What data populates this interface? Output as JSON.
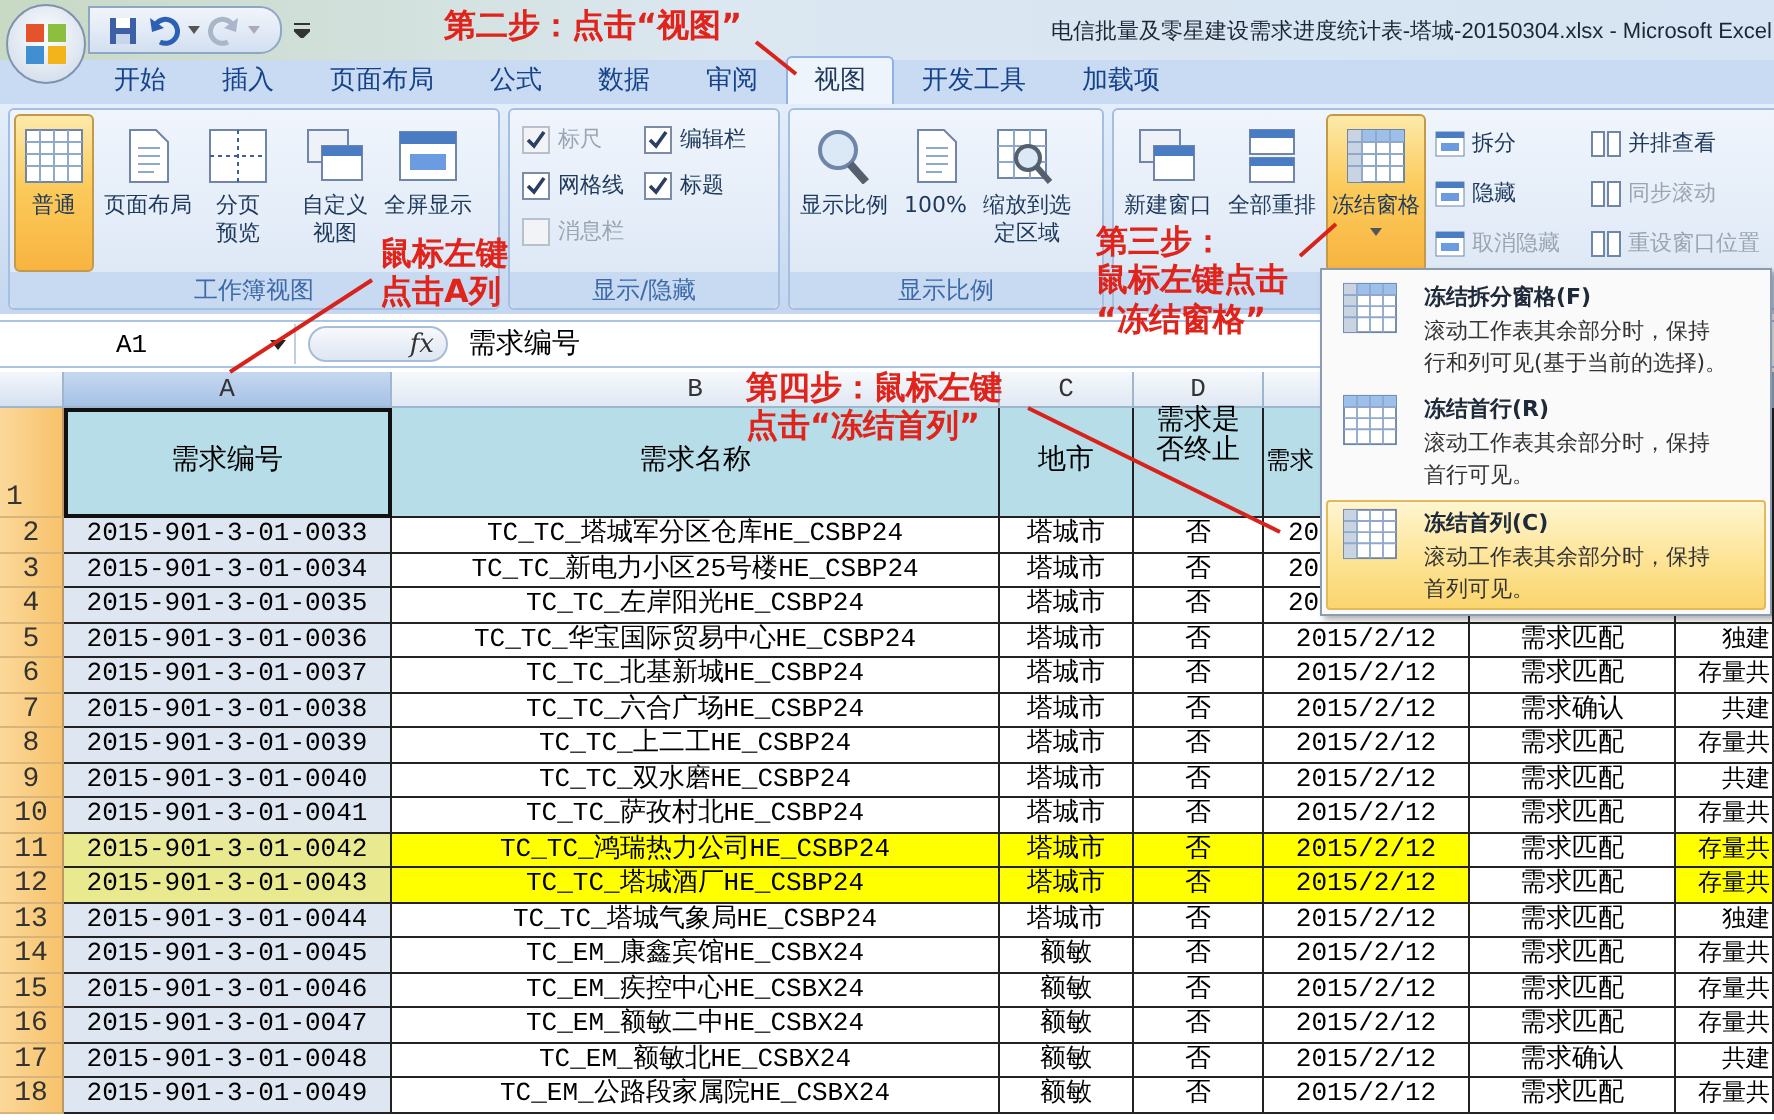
{
  "window": {
    "title": "电信批量及零星建设需求进度统计表-塔城-20150304.xlsx - Microsoft Excel"
  },
  "tabs": [
    {
      "label": "开始",
      "selected": false
    },
    {
      "label": "插入",
      "selected": false
    },
    {
      "label": "页面布局",
      "selected": false
    },
    {
      "label": "公式",
      "selected": false
    },
    {
      "label": "数据",
      "selected": false
    },
    {
      "label": "审阅",
      "selected": false
    },
    {
      "label": "视图",
      "selected": true
    },
    {
      "label": "开发工具",
      "selected": false
    },
    {
      "label": "加载项",
      "selected": false
    }
  ],
  "ribbon": {
    "workbook_views": {
      "label": "工作簿视图",
      "buttons": [
        {
          "label": "普通",
          "selected": true
        },
        {
          "label": "页面布局",
          "selected": false
        },
        {
          "label": "分页预览",
          "selected": false
        },
        {
          "label": "自定义视图",
          "selected": false
        },
        {
          "label": "全屏显示",
          "selected": false
        }
      ]
    },
    "show_hide": {
      "label": "显示/隐藏",
      "checkboxes": [
        {
          "label": "标尺",
          "checked": true,
          "disabled": true
        },
        {
          "label": "编辑栏",
          "checked": true,
          "disabled": false
        },
        {
          "label": "网格线",
          "checked": true,
          "disabled": false
        },
        {
          "label": "标题",
          "checked": true,
          "disabled": false
        },
        {
          "label": "消息栏",
          "checked": false,
          "disabled": true
        }
      ]
    },
    "zoom": {
      "label": "显示比例",
      "buttons": [
        {
          "label": "显示比例",
          "selected": false
        },
        {
          "label": "100%",
          "selected": false
        },
        {
          "label": "缩放到选定区域",
          "selected": false
        }
      ]
    },
    "window": {
      "buttons": [
        {
          "label": "新建窗口",
          "selected": false
        },
        {
          "label": "全部重排",
          "selected": false
        },
        {
          "label": "冻结窗格",
          "selected": true
        }
      ],
      "small_buttons": [
        {
          "label": "拆分",
          "disabled": false
        },
        {
          "label": "隐藏",
          "disabled": false
        },
        {
          "label": "取消隐藏",
          "disabled": true
        },
        {
          "label": "并排查看",
          "disabled": false
        },
        {
          "label": "同步滚动",
          "disabled": true
        },
        {
          "label": "重设窗口位置",
          "disabled": true
        }
      ]
    }
  },
  "formula_bar": {
    "name_box": "A1",
    "function_label": "fx",
    "content": "需求编号"
  },
  "sheet": {
    "columns": [
      {
        "letter": "A",
        "header": "需求编号",
        "selected": true
      },
      {
        "letter": "B",
        "header": "需求名称",
        "selected": false
      },
      {
        "letter": "C",
        "header": "地市",
        "selected": false
      },
      {
        "letter": "D",
        "header": "需求是否终止",
        "selected": false
      },
      {
        "header": "需求",
        "selected": false
      }
    ],
    "header_row": "1",
    "rows": [
      {
        "row": "2",
        "cells": [
          "2015-901-3-01-0033",
          "TC_TC_塔城军分区仓库HE_CSBP24",
          "塔城市",
          "否",
          "20"
        ],
        "highlighted": [
          false,
          false,
          false,
          false,
          false
        ]
      },
      {
        "row": "3",
        "cells": [
          "2015-901-3-01-0034",
          "TC_TC_新电力小区25号楼HE_CSBP24",
          "塔城市",
          "否",
          "20"
        ],
        "highlighted": [
          false,
          false,
          false,
          false,
          false
        ]
      },
      {
        "row": "4",
        "cells": [
          "2015-901-3-01-0035",
          "TC_TC_左岸阳光HE_CSBP24",
          "塔城市",
          "否",
          "20"
        ],
        "highlighted": [
          false,
          false,
          false,
          false,
          false
        ]
      },
      {
        "row": "5",
        "cells": [
          "2015-901-3-01-0036",
          "TC_TC_华宝国际贸易中心HE_CSBP24",
          "塔城市",
          "否",
          "2015/2/12",
          "需求匹配",
          "独建"
        ],
        "highlighted": [
          false,
          false,
          false,
          false,
          false,
          false,
          false
        ]
      },
      {
        "row": "6",
        "cells": [
          "2015-901-3-01-0037",
          "TC_TC_北基新城HE_CSBP24",
          "塔城市",
          "否",
          "2015/2/12",
          "需求匹配",
          "存量共"
        ],
        "highlighted": [
          false,
          false,
          false,
          false,
          false,
          false,
          false
        ]
      },
      {
        "row": "7",
        "cells": [
          "2015-901-3-01-0038",
          "TC_TC_六合广场HE_CSBP24",
          "塔城市",
          "否",
          "2015/2/12",
          "需求确认",
          "共建"
        ],
        "highlighted": [
          false,
          false,
          false,
          false,
          false,
          false,
          false
        ]
      },
      {
        "row": "8",
        "cells": [
          "2015-901-3-01-0039",
          "TC_TC_上二工HE_CSBP24",
          "塔城市",
          "否",
          "2015/2/12",
          "需求匹配",
          "存量共"
        ],
        "highlighted": [
          false,
          false,
          false,
          false,
          false,
          false,
          false
        ]
      },
      {
        "row": "9",
        "cells": [
          "2015-901-3-01-0040",
          "TC_TC_双水磨HE_CSBP24",
          "塔城市",
          "否",
          "2015/2/12",
          "需求匹配",
          "共建"
        ],
        "highlighted": [
          false,
          false,
          false,
          false,
          false,
          false,
          false
        ]
      },
      {
        "row": "10",
        "cells": [
          "2015-901-3-01-0041",
          "TC_TC_萨孜村北HE_CSBP24",
          "塔城市",
          "否",
          "2015/2/12",
          "需求匹配",
          "存量共"
        ],
        "highlighted": [
          false,
          false,
          false,
          false,
          false,
          false,
          false
        ]
      },
      {
        "row": "11",
        "cells": [
          "2015-901-3-01-0042",
          "TC_TC_鸿瑞热力公司HE_CSBP24",
          "塔城市",
          "否",
          "2015/2/12",
          "需求匹配",
          "存量共"
        ],
        "highlighted": [
          true,
          true,
          true,
          true,
          true,
          false,
          true
        ]
      },
      {
        "row": "12",
        "cells": [
          "2015-901-3-01-0043",
          "TC_TC_塔城酒厂HE_CSBP24",
          "塔城市",
          "否",
          "2015/2/12",
          "需求匹配",
          "存量共"
        ],
        "highlighted": [
          true,
          true,
          true,
          true,
          true,
          false,
          true
        ]
      },
      {
        "row": "13",
        "cells": [
          "2015-901-3-01-0044",
          "TC_TC_塔城气象局HE_CSBP24",
          "塔城市",
          "否",
          "2015/2/12",
          "需求匹配",
          "独建"
        ],
        "highlighted": [
          false,
          false,
          false,
          false,
          false,
          false,
          false
        ]
      },
      {
        "row": "14",
        "cells": [
          "2015-901-3-01-0045",
          "TC_EM_康鑫宾馆HE_CSBX24",
          "额敏",
          "否",
          "2015/2/12",
          "需求匹配",
          "存量共"
        ],
        "highlighted": [
          false,
          false,
          false,
          false,
          false,
          false,
          false
        ]
      },
      {
        "row": "15",
        "cells": [
          "2015-901-3-01-0046",
          "TC_EM_疾控中心HE_CSBX24",
          "额敏",
          "否",
          "2015/2/12",
          "需求匹配",
          "存量共"
        ],
        "highlighted": [
          false,
          false,
          false,
          false,
          false,
          false,
          false
        ]
      },
      {
        "row": "16",
        "cells": [
          "2015-901-3-01-0047",
          "TC_EM_额敏二中HE_CSBX24",
          "额敏",
          "否",
          "2015/2/12",
          "需求匹配",
          "存量共"
        ],
        "highlighted": [
          false,
          false,
          false,
          false,
          false,
          false,
          false
        ]
      },
      {
        "row": "17",
        "cells": [
          "2015-901-3-01-0048",
          "TC_EM_额敏北HE_CSBX24",
          "额敏",
          "否",
          "2015/2/12",
          "需求确认",
          "共建"
        ],
        "highlighted": [
          false,
          false,
          false,
          false,
          false,
          false,
          false
        ]
      },
      {
        "row": "18",
        "cells": [
          "2015-901-3-01-0049",
          "TC_EM_公路段家属院HE_CSBX24",
          "额敏",
          "否",
          "2015/2/12",
          "需求匹配",
          "存量共"
        ],
        "highlighted": [
          false,
          false,
          false,
          false,
          false,
          false,
          false
        ]
      }
    ]
  },
  "freeze_menu": {
    "items": [
      {
        "title": "冻结拆分窗格(F)",
        "description": "滚动工作表其余部分时，保持行和列可见(基于当前的选择)。",
        "selected": false
      },
      {
        "title": "冻结首行(R)",
        "description": "滚动工作表其余部分时，保持首行可见。",
        "selected": false
      },
      {
        "title": "冻结首列(C)",
        "description": "滚动工作表其余部分时，保持首列可见。",
        "selected": true
      }
    ]
  },
  "annotations": [
    {
      "text": "第二步：点击“视图”"
    },
    {
      "text": "鼠标左键"
    },
    {
      "text": "点击A列"
    },
    {
      "text": "第三步："
    },
    {
      "text": "鼠标左键点击"
    },
    {
      "text": "“冻结窗格”"
    },
    {
      "text": "第四步：鼠标左键"
    },
    {
      "text": "点击“冻结首列”"
    }
  ]
}
